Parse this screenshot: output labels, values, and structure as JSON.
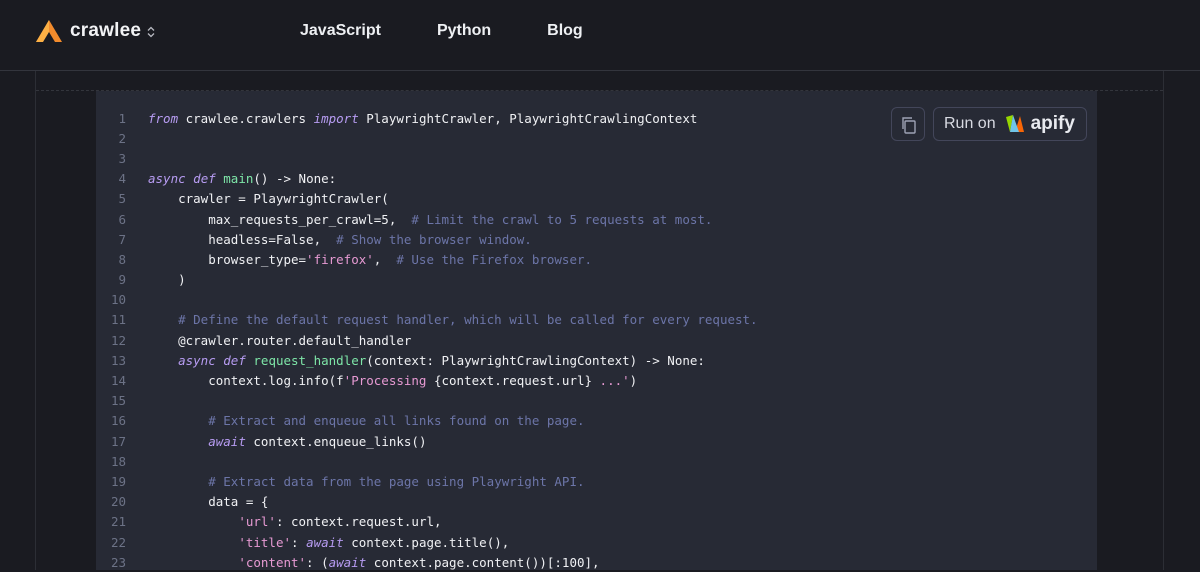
{
  "brand": {
    "name": "crawlee",
    "chevron": "⌃⌄"
  },
  "nav": [
    {
      "label": "JavaScript"
    },
    {
      "label": "Python"
    },
    {
      "label": "Blog"
    }
  ],
  "actions": {
    "run_label": "Run on",
    "apify_label": "apify"
  },
  "colors": {
    "background": "#1a1b21",
    "code_bg": "#272a35",
    "keyword": "#b79cf2",
    "function": "#7ee6a8",
    "string": "#e79ad3",
    "comment": "#6c75a8"
  },
  "code": [
    {
      "n": "1",
      "tokens": [
        {
          "t": "from",
          "k": "kw"
        },
        {
          "t": " crawlee.crawlers ",
          "k": "default"
        },
        {
          "t": "import",
          "k": "kw"
        },
        {
          "t": " PlaywrightCrawler, PlaywrightCrawlingContext",
          "k": "default"
        }
      ]
    },
    {
      "n": "2",
      "tokens": []
    },
    {
      "n": "3",
      "tokens": []
    },
    {
      "n": "4",
      "tokens": [
        {
          "t": "async",
          "k": "kw"
        },
        {
          "t": " ",
          "k": "default"
        },
        {
          "t": "def",
          "k": "kw"
        },
        {
          "t": " ",
          "k": "default"
        },
        {
          "t": "main",
          "k": "fn"
        },
        {
          "t": "() -> None:",
          "k": "default"
        }
      ]
    },
    {
      "n": "5",
      "tokens": [
        {
          "t": "    crawler = PlaywrightCrawler(",
          "k": "default"
        }
      ]
    },
    {
      "n": "6",
      "tokens": [
        {
          "t": "        max_requests_per_crawl=5,  ",
          "k": "default"
        },
        {
          "t": "# Limit the crawl to 5 requests at most.",
          "k": "com"
        }
      ]
    },
    {
      "n": "7",
      "tokens": [
        {
          "t": "        headless=False,  ",
          "k": "default"
        },
        {
          "t": "# Show the browser window.",
          "k": "com"
        }
      ]
    },
    {
      "n": "8",
      "tokens": [
        {
          "t": "        browser_type=",
          "k": "default"
        },
        {
          "t": "'firefox'",
          "k": "str"
        },
        {
          "t": ",  ",
          "k": "default"
        },
        {
          "t": "# Use the Firefox browser.",
          "k": "com"
        }
      ]
    },
    {
      "n": "9",
      "tokens": [
        {
          "t": "    )",
          "k": "default"
        }
      ]
    },
    {
      "n": "10",
      "tokens": []
    },
    {
      "n": "11",
      "tokens": [
        {
          "t": "    ",
          "k": "default"
        },
        {
          "t": "# Define the default request handler, which will be called for every request.",
          "k": "com"
        }
      ]
    },
    {
      "n": "12",
      "tokens": [
        {
          "t": "    @crawler.router.default_handler",
          "k": "default"
        }
      ]
    },
    {
      "n": "13",
      "tokens": [
        {
          "t": "    ",
          "k": "default"
        },
        {
          "t": "async",
          "k": "kw"
        },
        {
          "t": " ",
          "k": "default"
        },
        {
          "t": "def",
          "k": "kw"
        },
        {
          "t": " ",
          "k": "default"
        },
        {
          "t": "request_handler",
          "k": "fn"
        },
        {
          "t": "(context: PlaywrightCrawlingContext) -> None:",
          "k": "default"
        }
      ]
    },
    {
      "n": "14",
      "tokens": [
        {
          "t": "        context.log.info(f",
          "k": "default"
        },
        {
          "t": "'Processing ",
          "k": "str"
        },
        {
          "t": "{context.request.url}",
          "k": "default"
        },
        {
          "t": " ...'",
          "k": "str"
        },
        {
          "t": ")",
          "k": "default"
        }
      ]
    },
    {
      "n": "15",
      "tokens": []
    },
    {
      "n": "16",
      "tokens": [
        {
          "t": "        ",
          "k": "default"
        },
        {
          "t": "# Extract and enqueue all links found on the page.",
          "k": "com"
        }
      ]
    },
    {
      "n": "17",
      "tokens": [
        {
          "t": "        ",
          "k": "default"
        },
        {
          "t": "await",
          "k": "kw"
        },
        {
          "t": " context.enqueue_links()",
          "k": "default"
        }
      ]
    },
    {
      "n": "18",
      "tokens": []
    },
    {
      "n": "19",
      "tokens": [
        {
          "t": "        ",
          "k": "default"
        },
        {
          "t": "# Extract data from the page using Playwright API.",
          "k": "com"
        }
      ]
    },
    {
      "n": "20",
      "tokens": [
        {
          "t": "        data = {",
          "k": "default"
        }
      ]
    },
    {
      "n": "21",
      "tokens": [
        {
          "t": "            ",
          "k": "default"
        },
        {
          "t": "'url'",
          "k": "str"
        },
        {
          "t": ": context.request.url,",
          "k": "default"
        }
      ]
    },
    {
      "n": "22",
      "tokens": [
        {
          "t": "            ",
          "k": "default"
        },
        {
          "t": "'title'",
          "k": "str"
        },
        {
          "t": ": ",
          "k": "default"
        },
        {
          "t": "await",
          "k": "kw"
        },
        {
          "t": " context.page.title(),",
          "k": "default"
        }
      ]
    },
    {
      "n": "23",
      "tokens": [
        {
          "t": "            ",
          "k": "default"
        },
        {
          "t": "'content'",
          "k": "str"
        },
        {
          "t": ": (",
          "k": "default"
        },
        {
          "t": "await",
          "k": "kw"
        },
        {
          "t": " context.page.content())[:100],",
          "k": "default"
        }
      ]
    }
  ]
}
